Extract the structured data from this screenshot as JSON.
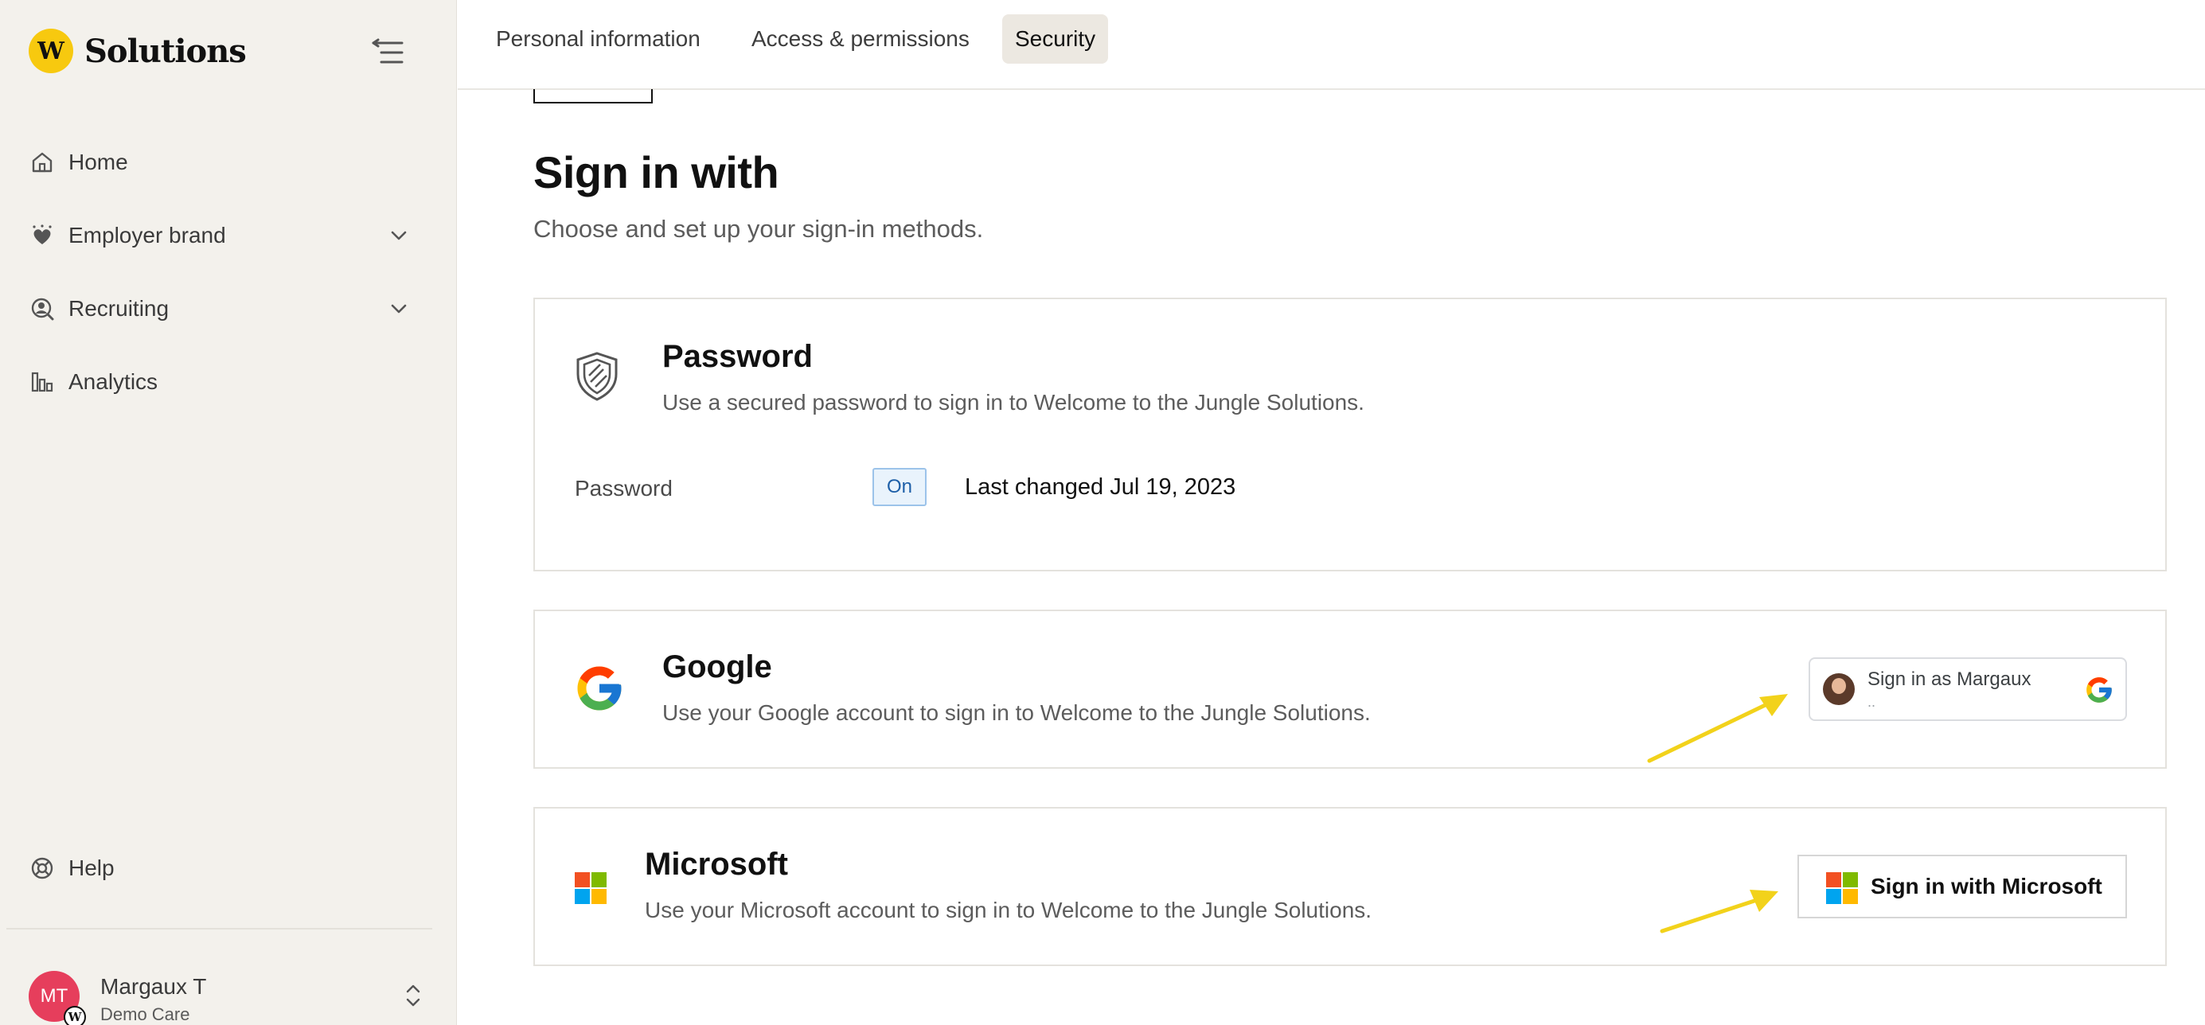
{
  "sidebar": {
    "brand": {
      "logo_letter": "W",
      "name": "Solutions"
    },
    "items": [
      {
        "label": "Home",
        "icon": "home-icon"
      },
      {
        "label": "Employer brand",
        "icon": "heart-icon",
        "expandable": true
      },
      {
        "label": "Recruiting",
        "icon": "recruiting-icon",
        "expandable": true
      },
      {
        "label": "Analytics",
        "icon": "analytics-icon"
      }
    ],
    "help": {
      "label": "Help",
      "icon": "lifebuoy-icon"
    },
    "user": {
      "initials": "MT",
      "name": "Margaux T",
      "org": "Demo Care"
    }
  },
  "tabs": [
    {
      "label": "Personal information",
      "active": false
    },
    {
      "label": "Access & permissions",
      "active": false
    },
    {
      "label": "Security",
      "active": true
    }
  ],
  "main": {
    "title": "Sign in with",
    "subtitle": "Choose and set up your sign-in methods.",
    "password": {
      "title": "Password",
      "description": "Use a secured password to sign in to Welcome to the Jungle Solutions.",
      "row_label": "Password",
      "status": "On",
      "last_changed": "Last changed Jul 19, 2023"
    },
    "google": {
      "title": "Google",
      "description": "Use your Google account to sign in to Welcome to the Jungle Solutions.",
      "button_label": "Sign in as Margaux",
      "button_sub": ".."
    },
    "microsoft": {
      "title": "Microsoft",
      "description": "Use your Microsoft account to sign in to Welcome to the Jungle Solutions.",
      "button_label": "Sign in with Microsoft"
    }
  },
  "colors": {
    "accent": "#f7c90f",
    "annotation_arrow": "#f2d21b",
    "status_on_bg": "#e9f3fc",
    "status_on_text": "#1d5fa8",
    "avatar": "#e63e5c"
  }
}
